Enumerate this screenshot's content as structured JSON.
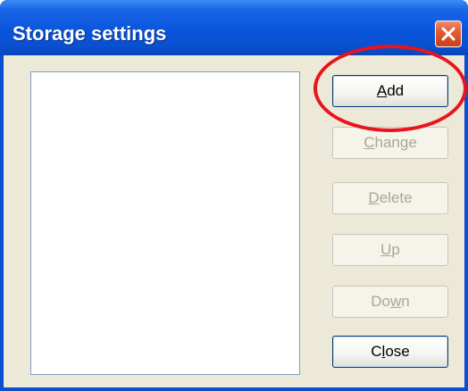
{
  "window": {
    "title": "Storage settings"
  },
  "buttons": {
    "add": {
      "prefix": "",
      "mnemonic": "A",
      "suffix": "dd",
      "enabled": true
    },
    "change": {
      "prefix": "",
      "mnemonic": "C",
      "suffix": "hange",
      "enabled": false
    },
    "delete": {
      "prefix": "",
      "mnemonic": "D",
      "suffix": "elete",
      "enabled": false
    },
    "up": {
      "prefix": "",
      "mnemonic": "U",
      "suffix": "p",
      "enabled": false
    },
    "down": {
      "prefix": "Do",
      "mnemonic": "w",
      "suffix": "n",
      "enabled": false
    },
    "close": {
      "prefix": "C",
      "mnemonic": "l",
      "suffix": "ose",
      "enabled": true
    }
  },
  "list": {
    "items": []
  },
  "colors": {
    "titlebar": "#0a4fd0",
    "client": "#ece9d8",
    "highlight": "#e8141e"
  },
  "icons": {
    "close": "close-icon"
  }
}
